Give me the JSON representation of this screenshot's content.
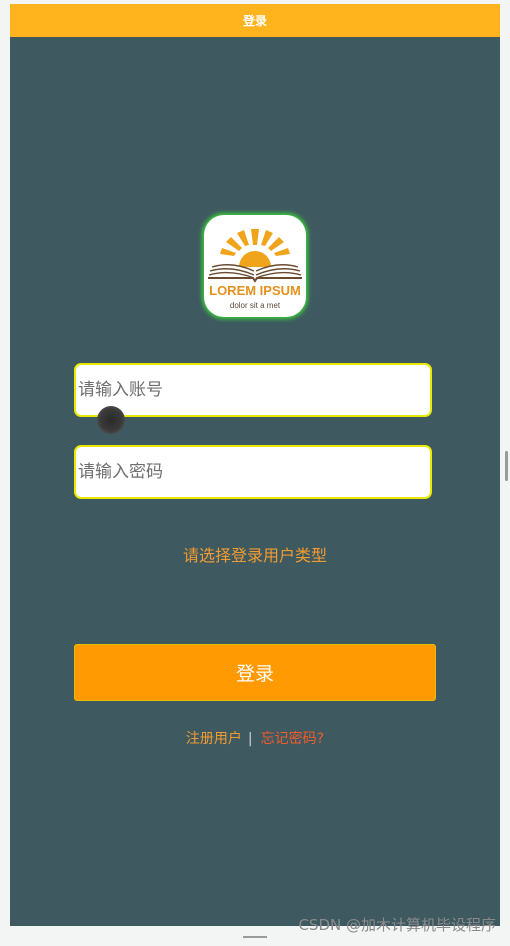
{
  "header": {
    "title": "登录"
  },
  "logo": {
    "title": "LOREM IPSUM",
    "subtitle": "dolor sit a met"
  },
  "form": {
    "account_placeholder": "请输入账号",
    "password_placeholder": "请输入密码",
    "user_type_prompt": "请选择登录用户类型",
    "login_label": "登录"
  },
  "links": {
    "register_label": "注册用户",
    "separator": "|",
    "forgot_label": "忘记密码?"
  },
  "watermark": {
    "text": "CSDN @加木计算机毕设程序"
  },
  "colors": {
    "titlebar": "#ffb31c",
    "background": "#3e5a60",
    "accent": "#ff9a02",
    "input_border": "#e8e800",
    "forgot_link": "#f25a2a"
  }
}
